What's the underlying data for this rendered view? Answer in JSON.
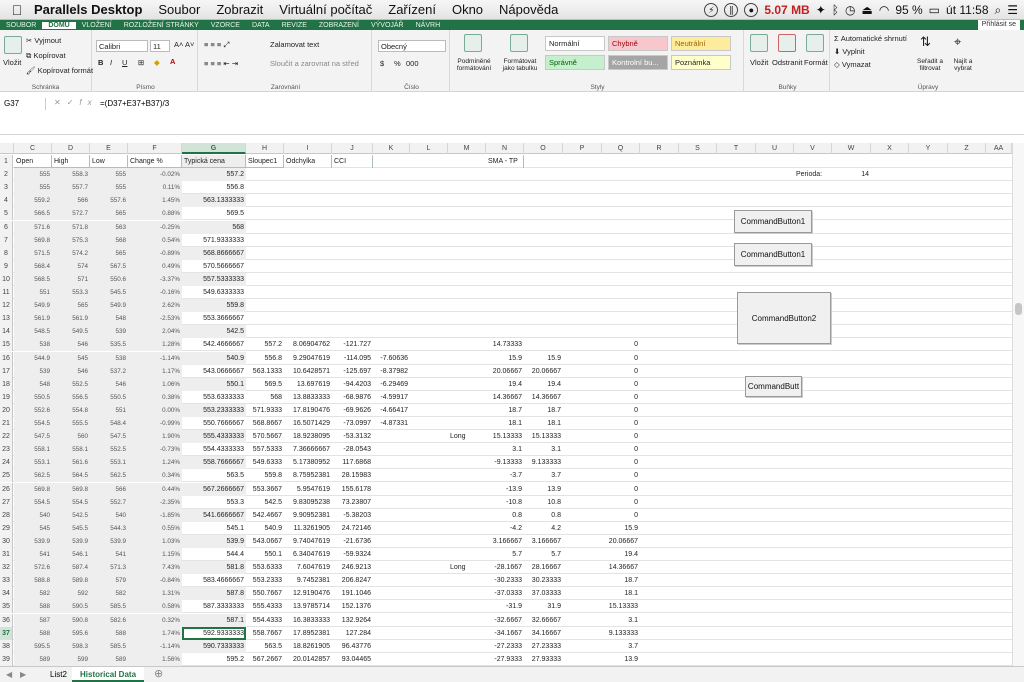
{
  "menubar": {
    "app": "Parallels Desktop",
    "items": [
      "Soubor",
      "Zobrazit",
      "Virtuální počítač",
      "Zařízení",
      "Okno",
      "Nápověda"
    ],
    "memory": "5.07 MB",
    "battery": "95 %",
    "clock": "út 11:58"
  },
  "ribbon_tabs": {
    "items": [
      "SOUBOR",
      "DOMŮ",
      "VLOŽENÍ",
      "ROZLOŽENÍ STRÁNKY",
      "VZORCE",
      "DATA",
      "REVIZE",
      "ZOBRAZENÍ",
      "VÝVOJÁŘ",
      "NÁVRH"
    ],
    "active": 1,
    "login": "Přihlásit se"
  },
  "ribbon": {
    "clipboard": {
      "paste": "Vložit",
      "cut": "Vyjmout",
      "copy": "Kopírovat",
      "format": "Kopírovat formát",
      "label": "Schránka"
    },
    "font": {
      "name": "Calibri",
      "size": "11",
      "label": "Písmo",
      "bold": "B",
      "italic": "I",
      "underline": "U"
    },
    "alignment": {
      "wrap": "Zalamovat text",
      "merge": "Sloučit a zarovnat na střed",
      "label": "Zarovnání"
    },
    "number": {
      "format": "Obecný",
      "currency": "$",
      "percent": "%",
      "comma": "000",
      "label": "Číslo"
    },
    "styles": {
      "cond": "Podmíněné formátování",
      "table": "Formátovat jako tabulku",
      "cells": [
        {
          "t": "Normální",
          "bg": "#ffffff",
          "fg": "#222222"
        },
        {
          "t": "Chybně",
          "bg": "#f8c7ce",
          "fg": "#9c0006"
        },
        {
          "t": "Neutrální",
          "bg": "#ffeb9c",
          "fg": "#9c6500"
        },
        {
          "t": "Správně",
          "bg": "#c6efce",
          "fg": "#006100"
        },
        {
          "t": "Kontrolní bu...",
          "bg": "#a5a5a5",
          "fg": "#ffffff"
        },
        {
          "t": "Poznámka",
          "bg": "#ffffcc",
          "fg": "#222222"
        }
      ],
      "label": "Styly"
    },
    "cells_grp": {
      "insert": "Vložit",
      "delete": "Odstranit",
      "format": "Formát",
      "label": "Buňky"
    },
    "editing": {
      "autosum": "Automatické shrnutí",
      "fill": "Vyplnit",
      "clear": "Vymazat",
      "sort": "Seřadit a filtrovat",
      "find": "Najít a vybrat",
      "label": "Úpravy"
    }
  },
  "formula_bar": {
    "cell": "G37",
    "formula": "=(D37+E37+B37)/3",
    "fx": "fx"
  },
  "columns": [
    "C",
    "D",
    "E",
    "F",
    "G",
    "H",
    "I",
    "J",
    "K",
    "L",
    "M",
    "N",
    "O",
    "P",
    "Q",
    "R",
    "S",
    "T",
    "U",
    "V",
    "W",
    "X",
    "Y",
    "Z",
    "AA"
  ],
  "headers": {
    "C": "Open",
    "D": "High",
    "E": "Low",
    "F": "Change %",
    "G": "Typická cena",
    "H": "Sloupec1",
    "I": "Odchylka",
    "J": "CCI",
    "N": "SMA - TP"
  },
  "perioda": {
    "label": "Perioda:",
    "value": "14"
  },
  "buttons": [
    "CommandButton1",
    "CommandButton1",
    "CommandButton2",
    "CommandButt"
  ],
  "rows": [
    {
      "n": "2",
      "C": "555",
      "D": "558.3",
      "E": "555",
      "F": "-0.02%",
      "G": "557.2"
    },
    {
      "n": "3",
      "C": "555",
      "D": "557.7",
      "E": "555",
      "F": "0.11%",
      "G": "556.8"
    },
    {
      "n": "4",
      "C": "559.2",
      "D": "566",
      "E": "557.6",
      "F": "1.45%",
      "G": "563.1333333"
    },
    {
      "n": "5",
      "C": "566.5",
      "D": "572.7",
      "E": "565",
      "F": "0.88%",
      "G": "569.5"
    },
    {
      "n": "6",
      "C": "571.6",
      "D": "571.8",
      "E": "563",
      "F": "-0.25%",
      "G": "568"
    },
    {
      "n": "7",
      "C": "569.8",
      "D": "575.3",
      "E": "568",
      "F": "0.54%",
      "G": "571.9333333"
    },
    {
      "n": "8",
      "C": "571.5",
      "D": "574.2",
      "E": "565",
      "F": "-0.89%",
      "G": "568.8666667"
    },
    {
      "n": "9",
      "C": "568.4",
      "D": "574",
      "E": "567.5",
      "F": "0.49%",
      "G": "570.5666667"
    },
    {
      "n": "10",
      "C": "568.5",
      "D": "571",
      "E": "550.6",
      "F": "-3.37%",
      "G": "557.5333333"
    },
    {
      "n": "11",
      "C": "551",
      "D": "553.3",
      "E": "545.5",
      "F": "-0.16%",
      "G": "549.6333333"
    },
    {
      "n": "12",
      "C": "549.9",
      "D": "565",
      "E": "549.9",
      "F": "2.62%",
      "G": "559.8"
    },
    {
      "n": "13",
      "C": "561.9",
      "D": "561.9",
      "E": "548",
      "F": "-2.53%",
      "G": "553.3666667"
    },
    {
      "n": "14",
      "C": "548.5",
      "D": "549.5",
      "E": "539",
      "F": "2.04%",
      "G": "542.5"
    },
    {
      "n": "15",
      "C": "538",
      "D": "546",
      "E": "535.5",
      "F": "1.28%",
      "G": "542.4666667",
      "H": "557.2",
      "I": "8.06904762",
      "J": "-121.727",
      "N": "14.73333",
      "Q": "0"
    },
    {
      "n": "16",
      "C": "544.9",
      "D": "545",
      "E": "538",
      "F": "-1.14%",
      "G": "540.9",
      "H": "556.8",
      "I": "9.29047619",
      "J": "-114.095",
      "K": "-7.60636",
      "N": "15.9",
      "O": "15.9",
      "Q": "0"
    },
    {
      "n": "17",
      "C": "539",
      "D": "546",
      "E": "537.2",
      "F": "1.17%",
      "G": "543.0666667",
      "H": "563.1333",
      "I": "10.6428571",
      "J": "-125.697",
      "K": "-8.37982",
      "N": "20.06667",
      "O": "20.06667",
      "Q": "0"
    },
    {
      "n": "18",
      "C": "548",
      "D": "552.5",
      "E": "546",
      "F": "1.06%",
      "G": "550.1",
      "H": "569.5",
      "I": "13.697619",
      "J": "-94.4203",
      "K": "-6.29469",
      "N": "19.4",
      "O": "19.4",
      "Q": "0"
    },
    {
      "n": "19",
      "C": "550.5",
      "D": "556.5",
      "E": "550.5",
      "F": "0.38%",
      "G": "553.6333333",
      "H": "568",
      "I": "13.8833333",
      "J": "-68.9876",
      "K": "-4.59917",
      "N": "14.36667",
      "O": "14.36667",
      "Q": "0"
    },
    {
      "n": "20",
      "C": "552.6",
      "D": "554.8",
      "E": "551",
      "F": "0.00%",
      "G": "553.2333333",
      "H": "571.9333",
      "I": "17.8190476",
      "J": "-69.9626",
      "K": "-4.66417",
      "N": "18.7",
      "O": "18.7",
      "Q": "0"
    },
    {
      "n": "21",
      "C": "554.5",
      "D": "555.5",
      "E": "548.4",
      "F": "-0.99%",
      "G": "550.7666667",
      "H": "568.8667",
      "I": "16.5071429",
      "J": "-73.0997",
      "K": "-4.87331",
      "N": "18.1",
      "O": "18.1",
      "Q": "0"
    },
    {
      "n": "22",
      "C": "547.5",
      "D": "560",
      "E": "547.5",
      "F": "1.90%",
      "G": "555.4333333",
      "H": "570.5667",
      "I": "18.9238095",
      "J": "-53.3132",
      "M": "Long",
      "N": "15.13333",
      "O": "15.13333",
      "Q": "0"
    },
    {
      "n": "23",
      "C": "558.1",
      "D": "558.1",
      "E": "552.5",
      "F": "-0.73%",
      "G": "554.4333333",
      "H": "557.5333",
      "I": "7.36666667",
      "J": "-28.0543",
      "N": "3.1",
      "O": "3.1",
      "Q": "0"
    },
    {
      "n": "24",
      "C": "553.1",
      "D": "561.6",
      "E": "553.1",
      "F": "1.24%",
      "G": "558.7666667",
      "H": "549.6333",
      "I": "5.17380952",
      "J": "117.6868",
      "N": "-9.13333",
      "O": "9.133333",
      "Q": "0"
    },
    {
      "n": "25",
      "C": "562.5",
      "D": "564.5",
      "E": "562.5",
      "F": "0.34%",
      "G": "563.5",
      "H": "559.8",
      "I": "8.75952381",
      "J": "28.15983",
      "N": "-3.7",
      "O": "3.7",
      "Q": "0"
    },
    {
      "n": "26",
      "C": "569.8",
      "D": "569.8",
      "E": "566",
      "F": "0.44%",
      "G": "567.2666667",
      "H": "553.3667",
      "I": "5.9547619",
      "J": "155.6178",
      "N": "-13.9",
      "O": "13.9",
      "Q": "0"
    },
    {
      "n": "27",
      "C": "554.5",
      "D": "554.5",
      "E": "552.7",
      "F": "-2.35%",
      "G": "553.3",
      "H": "542.5",
      "I": "9.83095238",
      "J": "73.23807",
      "N": "-10.8",
      "O": "10.8",
      "Q": "0"
    },
    {
      "n": "28",
      "C": "540",
      "D": "542.5",
      "E": "540",
      "F": "-1.85%",
      "G": "541.6666667",
      "H": "542.4667",
      "I": "9.90952381",
      "J": "-5.38203",
      "N": "0.8",
      "O": "0.8",
      "Q": "0"
    },
    {
      "n": "29",
      "C": "545",
      "D": "545.5",
      "E": "544.3",
      "F": "0.55%",
      "G": "545.1",
      "H": "540.9",
      "I": "11.3261905",
      "J": "24.72146",
      "N": "-4.2",
      "O": "4.2",
      "Q": "15.9"
    },
    {
      "n": "30",
      "C": "539.9",
      "D": "539.9",
      "E": "539.9",
      "F": "1.03%",
      "G": "539.9",
      "H": "543.0667",
      "I": "9.74047619",
      "J": "-21.6736",
      "N": "3.166667",
      "O": "3.166667",
      "Q": "20.06667"
    },
    {
      "n": "31",
      "C": "541",
      "D": "546.1",
      "E": "541",
      "F": "1.15%",
      "G": "544.4",
      "H": "550.1",
      "I": "6.34047619",
      "J": "-59.9324",
      "N": "5.7",
      "O": "5.7",
      "Q": "19.4"
    },
    {
      "n": "32",
      "C": "572.6",
      "D": "587.4",
      "E": "571.3",
      "F": "7.43%",
      "G": "581.8",
      "H": "553.6333",
      "I": "7.6047619",
      "J": "246.9213",
      "M": "Long",
      "N": "-28.1667",
      "O": "28.16667",
      "Q": "14.36667"
    },
    {
      "n": "33",
      "C": "588.8",
      "D": "589.8",
      "E": "579",
      "F": "-0.84%",
      "G": "583.4666667",
      "H": "553.2333",
      "I": "9.7452381",
      "J": "206.8247",
      "N": "-30.2333",
      "O": "30.23333",
      "Q": "18.7"
    },
    {
      "n": "34",
      "C": "582",
      "D": "592",
      "E": "582",
      "F": "1.31%",
      "G": "587.8",
      "H": "550.7667",
      "I": "12.9190476",
      "J": "191.1046",
      "N": "-37.0333",
      "O": "37.03333",
      "Q": "18.1"
    },
    {
      "n": "35",
      "C": "588",
      "D": "590.5",
      "E": "585.5",
      "F": "0.58%",
      "G": "587.3333333",
      "H": "555.4333",
      "I": "13.9785714",
      "J": "152.1376",
      "N": "-31.9",
      "O": "31.9",
      "Q": "15.13333"
    },
    {
      "n": "36",
      "C": "587",
      "D": "590.8",
      "E": "582.6",
      "F": "0.32%",
      "G": "587.1",
      "H": "554.4333",
      "I": "16.3833333",
      "J": "132.9264",
      "N": "-32.6667",
      "O": "32.66667",
      "Q": "3.1"
    },
    {
      "n": "37",
      "C": "588",
      "D": "595.6",
      "E": "588",
      "F": "1.74%",
      "G": "592.9333333",
      "H": "558.7667",
      "I": "17.8952381",
      "J": "127.284",
      "N": "-34.1667",
      "O": "34.16667",
      "Q": "9.133333"
    },
    {
      "n": "38",
      "C": "595.5",
      "D": "598.3",
      "E": "585.5",
      "F": "-1.14%",
      "G": "590.7333333",
      "H": "563.5",
      "I": "18.8261905",
      "J": "96.43776",
      "N": "-27.2333",
      "O": "27.23333",
      "Q": "3.7"
    },
    {
      "n": "39",
      "C": "589",
      "D": "599",
      "E": "589",
      "F": "1.56%",
      "G": "595.2",
      "H": "567.2667",
      "I": "20.0142857",
      "J": "93.04465",
      "N": "-27.9333",
      "O": "27.93333",
      "Q": "13.9"
    }
  ],
  "sheets": [
    "List2",
    "Historical Data"
  ],
  "active_sheet": 1
}
